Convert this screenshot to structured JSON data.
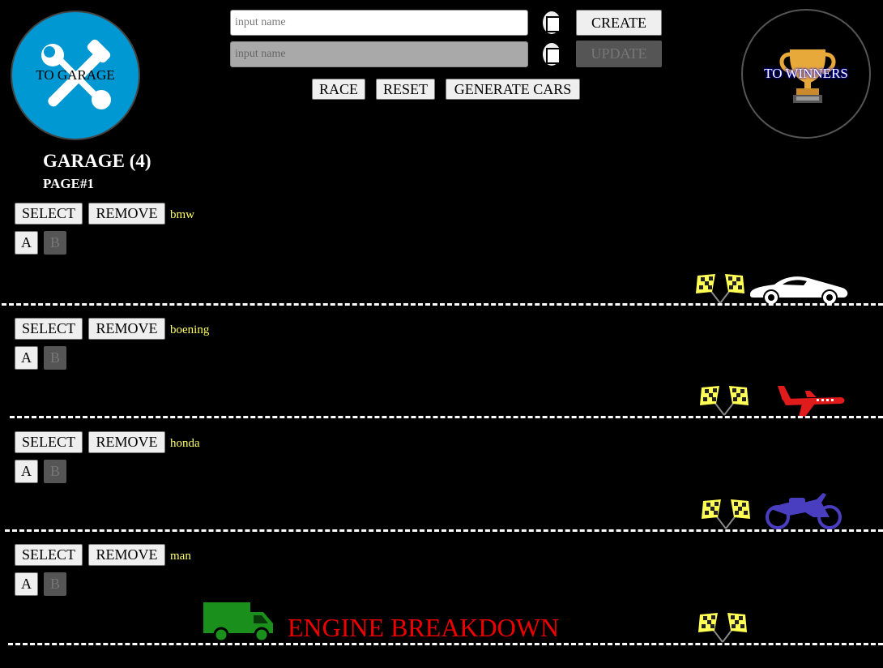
{
  "nav": {
    "garage_label": "TO GARAGE",
    "winners_label": "TO WINNERS",
    "garage_bg": "#0098d2",
    "garage_icon": "tools-icon",
    "winners_icon": "trophy-icon"
  },
  "create": {
    "placeholder": "input name",
    "button_label": "CREATE",
    "color": "#ffffff"
  },
  "update": {
    "placeholder": "input name",
    "button_label": "UPDATE",
    "color": "#ffffff"
  },
  "controls": {
    "race_label": "RACE",
    "reset_label": "RESET",
    "generate_label": "GENERATE CARS"
  },
  "garage": {
    "title": "GARAGE (4)",
    "page": "PAGE#1"
  },
  "cars": [
    {
      "name": "bmw",
      "select_label": "SELECT",
      "remove_label": "REMOVE",
      "a_label": "A",
      "b_label": "B",
      "vehicle_icon": "sports-car-icon",
      "color": "#ffffff",
      "status": ""
    },
    {
      "name": "boening",
      "select_label": "SELECT",
      "remove_label": "REMOVE",
      "a_label": "A",
      "b_label": "B",
      "vehicle_icon": "airplane-icon",
      "color": "#e01b1b",
      "status": ""
    },
    {
      "name": "honda",
      "select_label": "SELECT",
      "remove_label": "REMOVE",
      "a_label": "A",
      "b_label": "B",
      "vehicle_icon": "motorcycle-icon",
      "color": "#4a3ec0",
      "status": ""
    },
    {
      "name": "man",
      "select_label": "SELECT",
      "remove_label": "REMOVE",
      "a_label": "A",
      "b_label": "B",
      "vehicle_icon": "truck-icon",
      "color": "#1b8f1b",
      "status": "ENGINE BREAKDOWN"
    }
  ],
  "colors": {
    "car_name": "#ffff66",
    "breakdown": "#e00000",
    "flag": "#ffff55"
  }
}
